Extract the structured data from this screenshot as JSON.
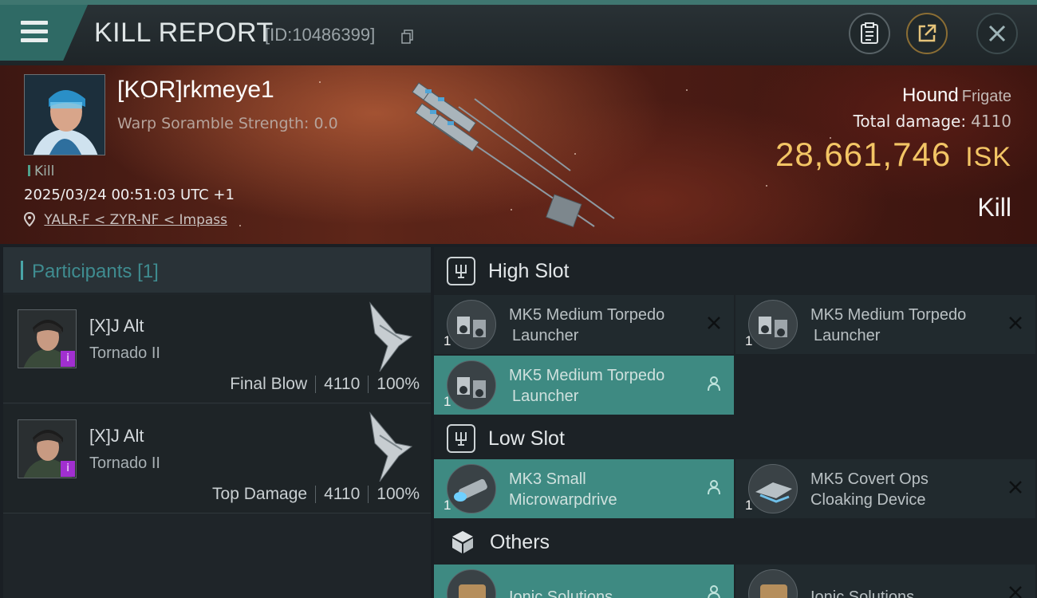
{
  "header": {
    "title": "KILL REPORT",
    "report_id": "[ID:10486399]"
  },
  "victim": {
    "pilot_name": "[KOR]rkmeye1",
    "warp_scramble": "Warp Soramble Strength: 0.0",
    "kill_tag": "Kill",
    "datetime": "2025/03/24 00:51:03 UTC +1",
    "location": "YALR-F < ZYR-NF < Impass",
    "ship_name": "Hound",
    "ship_class": "Frigate",
    "total_damage_label": "Total damage:",
    "total_damage": "4110",
    "isk_value": "28,661,746",
    "isk_unit": "ISK",
    "result": "Kill"
  },
  "participants": {
    "label": "Participants",
    "count": "[1]",
    "rows": [
      {
        "name": "[X]J Alt",
        "ship": "Tornado II",
        "role": "Final Blow",
        "damage": "4110",
        "percent": "100%"
      },
      {
        "name": "[X]J Alt",
        "ship": "Tornado II",
        "role": "Top Damage",
        "damage": "4110",
        "percent": "100%"
      }
    ]
  },
  "fittings": {
    "high_slot": "High Slot",
    "low_slot": "Low Slot",
    "others": "Others",
    "high_items": [
      {
        "line1": "MK5 Medium Torpedo",
        "line2": "Launcher",
        "qty": "1",
        "status": "destroyed"
      },
      {
        "line1": "MK5 Medium Torpedo",
        "line2": "Launcher",
        "qty": "1",
        "status": "destroyed"
      },
      {
        "line1": "MK5 Medium Torpedo",
        "line2": "Launcher",
        "qty": "1",
        "status": "dropped"
      }
    ],
    "low_items": [
      {
        "line1": "MK3 Small",
        "line2": "Microwarpdrive",
        "qty": "1",
        "status": "dropped"
      },
      {
        "line1": "MK5 Covert Ops",
        "line2": "Cloaking Device",
        "qty": "1",
        "status": "destroyed"
      }
    ],
    "other_items": [
      {
        "line1": "Ionic Solutions",
        "status": "dropped"
      },
      {
        "line1": "Ionic Solutions",
        "status": "destroyed"
      }
    ]
  },
  "colors": {
    "accent": "#3f7670",
    "isk": "#f3c565",
    "highlight_slot": "#3e8a82",
    "badge": "#a12fd0"
  }
}
